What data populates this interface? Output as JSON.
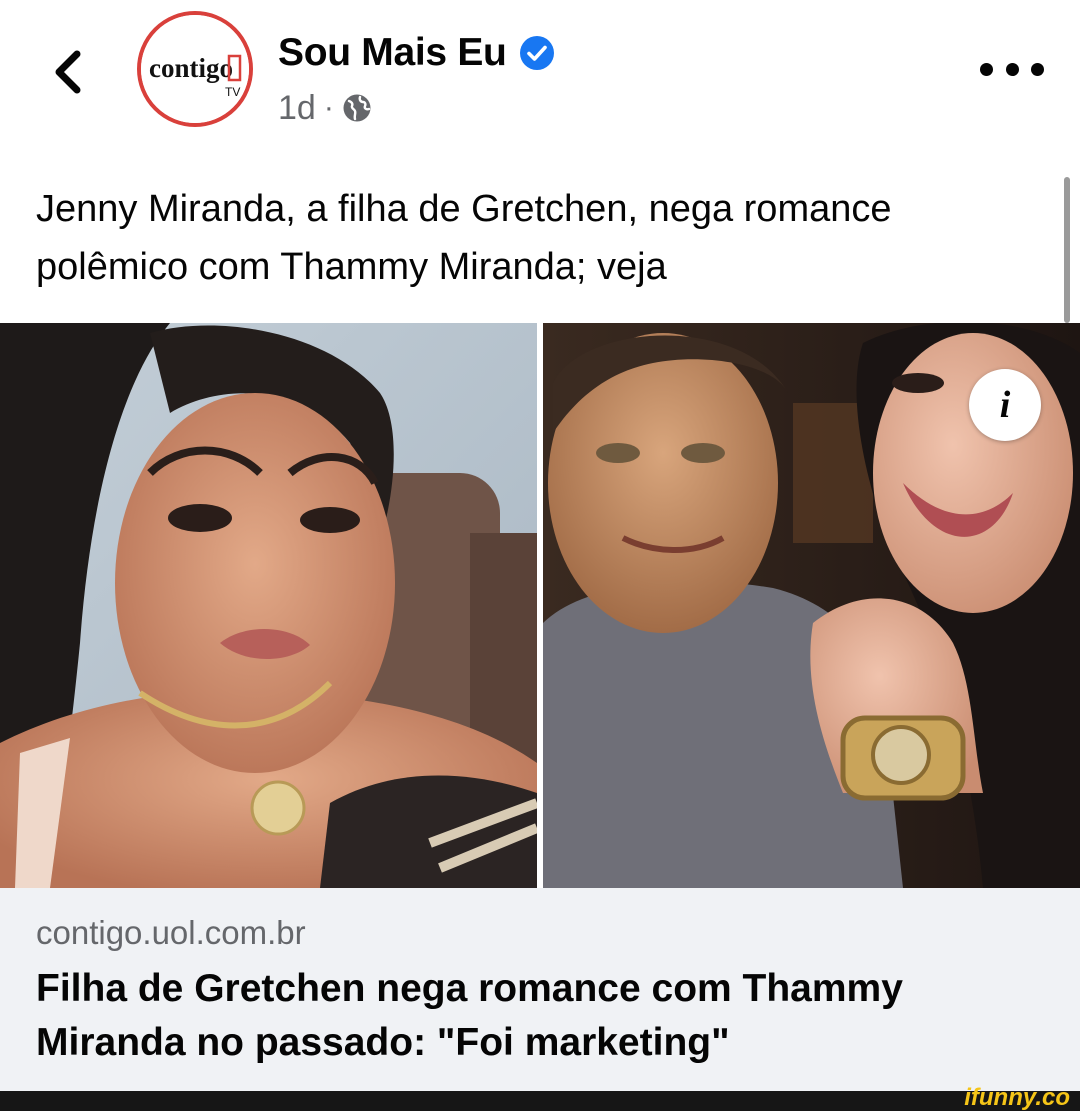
{
  "header": {
    "avatar_logo_text": "contigo",
    "avatar_logo_sub": "TV",
    "page_name": "Sou Mais Eu",
    "post_time": "1d",
    "meta_separator": "·",
    "icons": {
      "back": "chevron-left-icon",
      "verified": "verified-badge-icon",
      "privacy": "globe-icon",
      "more": "more-horizontal-icon"
    },
    "colors": {
      "verified": "#1877f2",
      "logo_ring": "#d9403b"
    }
  },
  "post": {
    "text_line_1": "Jenny Miranda, a filha de Gretchen, nega romance",
    "text_line_2": "polêmico com Thammy Miranda; veja"
  },
  "link": {
    "info_glyph": "i",
    "domain": "contigo.uol.com.br",
    "title_line_1": "Filha de Gretchen nega romance com Thammy",
    "title_line_2": "Miranda no passado: \"Foi marketing\""
  },
  "watermark": {
    "text": "ifunny.co",
    "color": "#f5c518"
  }
}
